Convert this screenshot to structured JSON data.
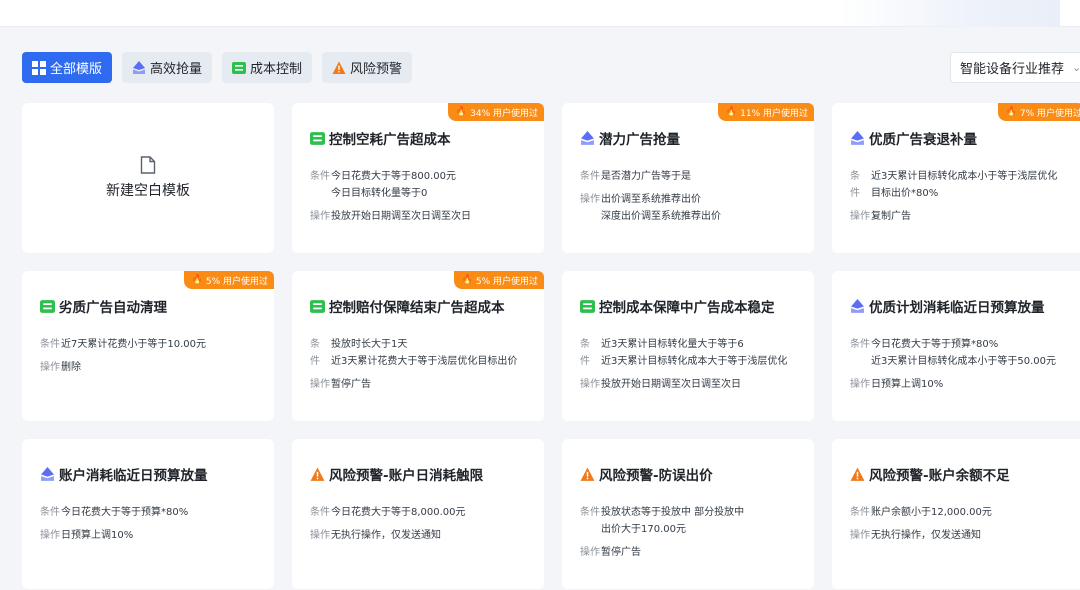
{
  "filters": [
    {
      "label": "全部模版",
      "icon": "grid-icon",
      "active": true
    },
    {
      "label": "高效抢量",
      "icon": "diamond-icon",
      "active": false
    },
    {
      "label": "成本控制",
      "icon": "cost-icon",
      "active": false
    },
    {
      "label": "风险预警",
      "icon": "warning-icon",
      "active": false
    }
  ],
  "industry_select": {
    "value": "智能设备行业推荐"
  },
  "new_template": {
    "label": "新建空白模板"
  },
  "labels": {
    "condition": "条件",
    "condition_top": "条",
    "condition_bottom": "件",
    "action": "操作"
  },
  "cards": [
    {
      "title": "控制空耗广告超成本",
      "icon": "cost-icon",
      "badge": "34% 用户使用过",
      "conditions": [
        "今日花费大于等于800.00元",
        "今日目标转化量等于0"
      ],
      "actions": [
        "投放开始日期调至次日调至次日"
      ]
    },
    {
      "title": "潜力广告抢量",
      "icon": "diamond-icon",
      "badge": "11% 用户使用过",
      "conditions": [
        "是否潜力广告等于是"
      ],
      "actions": [
        "出价调至系统推荐出价",
        "深度出价调至系统推荐出价"
      ]
    },
    {
      "title": "优质广告衰退补量",
      "icon": "diamond-icon",
      "badge": "7% 用户使用过",
      "conditions": [
        "近3天累计目标转化成本小于等于浅层优化",
        "目标出价*80%"
      ],
      "actions": [
        "复制广告"
      ]
    },
    {
      "title": "劣质广告自动清理",
      "icon": "cost-icon",
      "badge": "5% 用户使用过",
      "conditions": [
        "近7天累计花费小于等于10.00元"
      ],
      "actions": [
        "删除"
      ]
    },
    {
      "title": "控制赔付保障结束广告超成本",
      "icon": "cost-icon",
      "badge": "5% 用户使用过",
      "conditions": [
        "投放时长大于1天",
        "近3天累计花费大于等于浅层优化目标出价"
      ],
      "actions": [
        "暂停广告"
      ]
    },
    {
      "title": "控制成本保障中广告成本稳定",
      "icon": "cost-icon",
      "badge": "",
      "conditions": [
        "近3天累计目标转化量大于等于6",
        "近3天累计目标转化成本大于等于浅层优化"
      ],
      "actions": [
        "投放开始日期调至次日调至次日"
      ]
    },
    {
      "title": "优质计划消耗临近日预算放量",
      "icon": "diamond-icon",
      "badge": "",
      "conditions": [
        "今日花费大于等于预算*80%",
        "近3天累计目标转化成本小于等于50.00元"
      ],
      "actions": [
        "日预算上调10%"
      ]
    },
    {
      "title": "账户消耗临近日预算放量",
      "icon": "diamond-icon",
      "badge": "",
      "conditions": [
        "今日花费大于等于预算*80%"
      ],
      "actions": [
        "日预算上调10%"
      ]
    },
    {
      "title": "风险预警-账户日消耗触限",
      "icon": "warning-icon",
      "badge": "",
      "conditions": [
        "今日花费大于等于8,000.00元"
      ],
      "actions": [
        "无执行操作，仅发送通知"
      ]
    },
    {
      "title": "风险预警-防误出价",
      "icon": "warning-icon",
      "badge": "",
      "conditions": [
        "投放状态等于投放中 部分投放中",
        "出价大于170.00元"
      ],
      "actions": [
        "暂停广告"
      ]
    },
    {
      "title": "风险预警-账户余额不足",
      "icon": "warning-icon",
      "badge": "",
      "conditions": [
        "账户余额小于12,000.00元"
      ],
      "actions": [
        "无执行操作，仅发送通知"
      ]
    }
  ],
  "colors": {
    "primary": "#2f6bf0",
    "badge": "#fa8c16",
    "cost": "#2fbf4f",
    "diamond": "#5b6ef5",
    "warning": "#f07a1a"
  }
}
